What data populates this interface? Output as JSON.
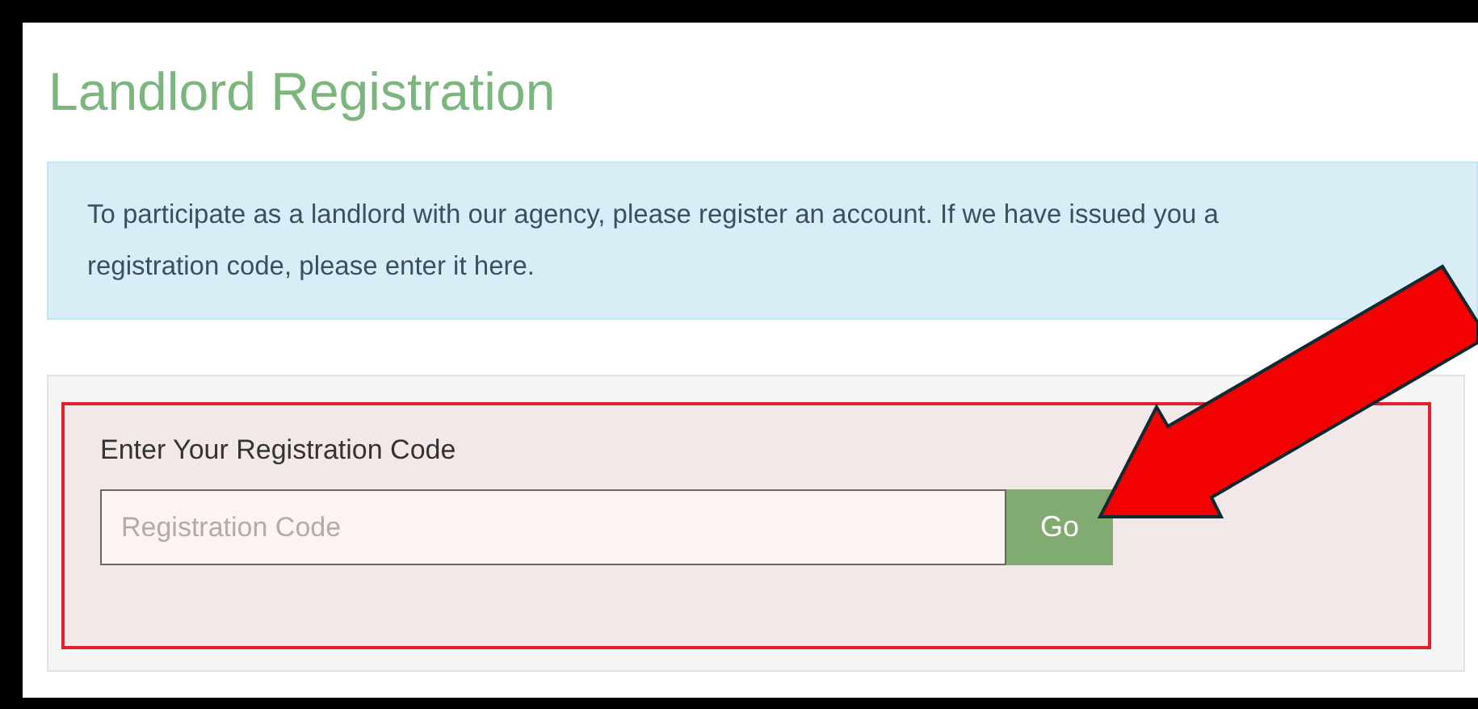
{
  "page": {
    "title": "Landlord Registration"
  },
  "notice": "To participate as a landlord with our agency, please register an account. If we have issued you a registration code, please enter it here.",
  "registration_form": {
    "label": "Enter Your Registration Code",
    "placeholder": "Registration Code",
    "button": "Go"
  }
}
